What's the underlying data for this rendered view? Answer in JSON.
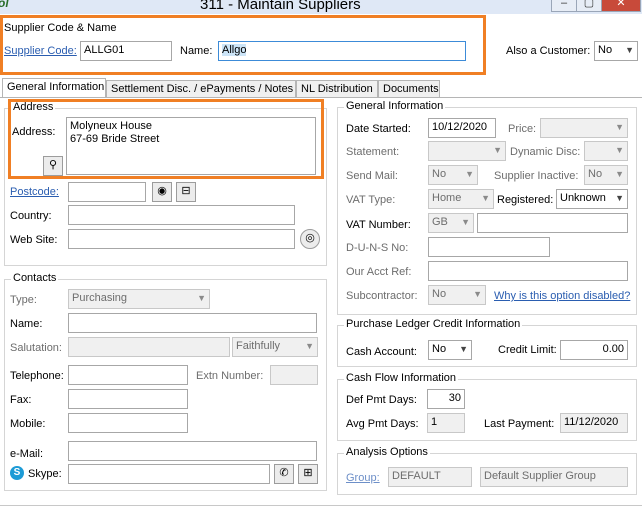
{
  "window": {
    "title": "311 - Maintain Suppliers",
    "logo_text": "ol"
  },
  "supplier": {
    "group_label": "Supplier Code & Name",
    "code_label": "Supplier Code:",
    "code_value": "ALLG01",
    "name_label": "Name:",
    "name_value": "Allgo",
    "customer_label": "Also a Customer:",
    "customer_value": "No"
  },
  "tabs": [
    {
      "label": "General Information"
    },
    {
      "label": "Settlement Disc. / ePayments / Notes"
    },
    {
      "label": "NL Distribution"
    },
    {
      "label": "Documents"
    }
  ],
  "address": {
    "group_label": "Address",
    "address_label": "Address:",
    "lines": [
      "Molyneux House",
      "67-69 Bride Street"
    ],
    "postcode_label": "Postcode:",
    "postcode_value": "",
    "country_label": "Country:",
    "country_value": "",
    "website_label": "Web Site:",
    "website_value": ""
  },
  "contacts": {
    "group_label": "Contacts",
    "type_label": "Type:",
    "type_value": "Purchasing",
    "name_label": "Name:",
    "salutation_label": "Salutation:",
    "salutation_value": "Faithfully",
    "telephone_label": "Telephone:",
    "extn_label": "Extn Number:",
    "fax_label": "Fax:",
    "mobile_label": "Mobile:",
    "email_label": "e-Mail:",
    "skype_label": "Skype:"
  },
  "general": {
    "group_label": "General Information",
    "date_started_label": "Date Started:",
    "date_started_value": "10/12/2020",
    "price_label": "Price:",
    "statement_label": "Statement:",
    "dynamic_disc_label": "Dynamic Disc:",
    "send_mail_label": "Send Mail:",
    "send_mail_value": "No",
    "supplier_inactive_label": "Supplier Inactive:",
    "supplier_inactive_value": "No",
    "vat_type_label": "VAT Type:",
    "vat_type_value": "Home",
    "registered_label": "Registered:",
    "registered_value": "Unknown",
    "vat_number_label": "VAT Number:",
    "vat_prefix_value": "GB",
    "duns_label": "D-U-N-S No:",
    "our_acct_label": "Our Acct Ref:",
    "subcontractor_label": "Subcontractor:",
    "subcontractor_value": "No",
    "why_disabled_link": "Why is this option disabled?"
  },
  "purchase_ledger": {
    "group_label": "Purchase Ledger Credit Information",
    "cash_account_label": "Cash Account:",
    "cash_account_value": "No",
    "credit_limit_label": "Credit Limit:",
    "credit_limit_value": "0.00"
  },
  "cash_flow": {
    "group_label": "Cash Flow Information",
    "def_pmt_label": "Def Pmt Days:",
    "def_pmt_value": "30",
    "avg_pmt_label": "Avg Pmt Days:",
    "avg_pmt_value": "1",
    "last_payment_label": "Last Payment:",
    "last_payment_value": "11/12/2020"
  },
  "analysis": {
    "group_label": "Analysis Options",
    "group_link": "Group:",
    "group_code": "DEFAULT",
    "group_desc": "Default Supplier Group"
  },
  "colors": {
    "highlight": "#f07f24",
    "link": "#2a5db0",
    "selection": "#cce4f7"
  }
}
